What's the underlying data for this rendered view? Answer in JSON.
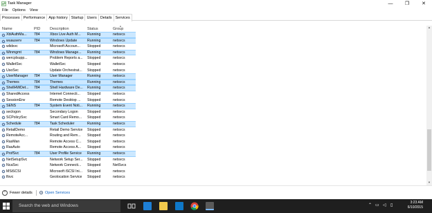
{
  "window": {
    "title": "Task Manager",
    "minimize_glyph": "—",
    "maximize_glyph": "❐",
    "close_glyph": "✕"
  },
  "menu": [
    "File",
    "Options",
    "View"
  ],
  "tabs": [
    "Processes",
    "Performance",
    "App history",
    "Startup",
    "Users",
    "Details",
    "Services"
  ],
  "active_tab": "Services",
  "columns": {
    "name": "Name",
    "pid": "PID",
    "description": "Description",
    "status": "Status",
    "group": "Group"
  },
  "rows": [
    {
      "name": "XblAuthMa...",
      "pid": "784",
      "description": "Xbox Live Auth M...",
      "status": "Running",
      "group": "netsvcs",
      "selected": true
    },
    {
      "name": "wuauserv",
      "pid": "784",
      "description": "Windows Update",
      "status": "Running",
      "group": "netsvcs",
      "selected": true
    },
    {
      "name": "wlidsvc",
      "pid": "",
      "description": "Microsoft Accoun...",
      "status": "Stopped",
      "group": "netsvcs",
      "selected": false
    },
    {
      "name": "Winmgmt",
      "pid": "784",
      "description": "Windows Manage...",
      "status": "Running",
      "group": "netsvcs",
      "selected": true
    },
    {
      "name": "wercplsupp...",
      "pid": "",
      "description": "Problem Reports a...",
      "status": "Stopped",
      "group": "netsvcs",
      "selected": false
    },
    {
      "name": "WalletSvc",
      "pid": "",
      "description": "WalletSvc",
      "status": "Stopped",
      "group": "netsvcs",
      "selected": false
    },
    {
      "name": "UsoSvc",
      "pid": "",
      "description": "Update Orchestrat...",
      "status": "Stopped",
      "group": "netsvcs",
      "selected": false
    },
    {
      "name": "UserManager",
      "pid": "784",
      "description": "User Manager",
      "status": "Running",
      "group": "netsvcs",
      "selected": true
    },
    {
      "name": "Themes",
      "pid": "784",
      "description": "Themes",
      "status": "Running",
      "group": "netsvcs",
      "selected": true
    },
    {
      "name": "ShellHWDet...",
      "pid": "784",
      "description": "Shell Hardware De...",
      "status": "Running",
      "group": "netsvcs",
      "selected": true
    },
    {
      "name": "SharedAccess",
      "pid": "",
      "description": "Internet Connecti...",
      "status": "Stopped",
      "group": "netsvcs",
      "selected": false
    },
    {
      "name": "SessionEnv",
      "pid": "",
      "description": "Remote Desktop ...",
      "status": "Stopped",
      "group": "netsvcs",
      "selected": false
    },
    {
      "name": "SENS",
      "pid": "784",
      "description": "System Event Noti...",
      "status": "Running",
      "group": "netsvcs",
      "selected": true
    },
    {
      "name": "seclogon",
      "pid": "",
      "description": "Secondary Logon",
      "status": "Stopped",
      "group": "netsvcs",
      "selected": false
    },
    {
      "name": "SCPolicySvc",
      "pid": "",
      "description": "Smart Card Remo...",
      "status": "Stopped",
      "group": "netsvcs",
      "selected": false
    },
    {
      "name": "Schedule",
      "pid": "784",
      "description": "Task Scheduler",
      "status": "Running",
      "group": "netsvcs",
      "selected": true
    },
    {
      "name": "RetailDemo",
      "pid": "",
      "description": "Retail Demo Service",
      "status": "Stopped",
      "group": "netsvcs",
      "selected": false
    },
    {
      "name": "RemoteAcc...",
      "pid": "",
      "description": "Routing and Rem...",
      "status": "Stopped",
      "group": "netsvcs",
      "selected": false
    },
    {
      "name": "RasMan",
      "pid": "",
      "description": "Remote Access C...",
      "status": "Stopped",
      "group": "netsvcs",
      "selected": false
    },
    {
      "name": "RasAuto",
      "pid": "",
      "description": "Remote Access A...",
      "status": "Stopped",
      "group": "netsvcs",
      "selected": false
    },
    {
      "name": "ProfSvc",
      "pid": "784",
      "description": "User Profile Service",
      "status": "Running",
      "group": "netsvcs",
      "selected": true
    },
    {
      "name": "NetSetupSvc",
      "pid": "",
      "description": "Network Setup Ser...",
      "status": "Stopped",
      "group": "netsvcs",
      "selected": false
    },
    {
      "name": "NcaSvc",
      "pid": "",
      "description": "Network Connecti...",
      "status": "Stopped",
      "group": "NetSvcs",
      "selected": false
    },
    {
      "name": "MSiSCSI",
      "pid": "",
      "description": "Microsoft iSCSI Ini...",
      "status": "Stopped",
      "group": "netsvcs",
      "selected": false
    },
    {
      "name": "lfsvc",
      "pid": "",
      "description": "Geolocation Service",
      "status": "Stopped",
      "group": "netsvcs",
      "selected": false
    }
  ],
  "footer": {
    "fewer_details": "Fewer details",
    "open_services": "Open Services"
  },
  "taskbar": {
    "search_placeholder": "Search the web and Windows",
    "time": "3:23 AM",
    "date": "6/10/2015"
  },
  "colors": {
    "selection": "#cce8ff",
    "selection_border": "#99d1ff",
    "link": "#0b62c4",
    "taskbar": "#1f1f1f"
  }
}
